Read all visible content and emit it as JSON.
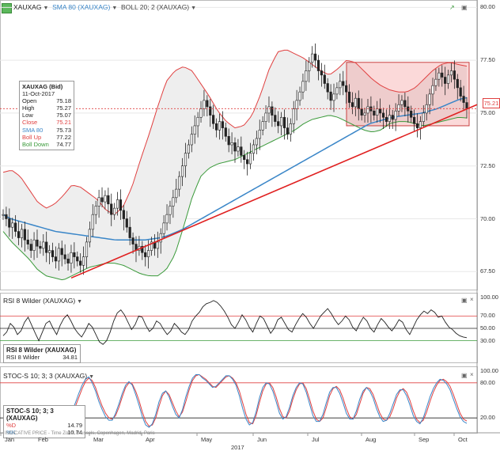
{
  "header": {
    "instrument": "XAUXAG",
    "sma": "SMA 80 (XAUXAG)",
    "boll": "BOLL 20; 2 (XAUXAG)"
  },
  "rsi_header": "RSI 8 Wilder (XAUXAG)",
  "stoch_header": "STOC-S 10; 3; 3 (XAUXAG)",
  "infobox": {
    "title": "XAUXAG (Bid)",
    "date": "11-Oct-2017",
    "rows": [
      {
        "label": "Open",
        "value": "75.18"
      },
      {
        "label": "High",
        "value": "75.27"
      },
      {
        "label": "Low",
        "value": "75.07"
      },
      {
        "label": "Close",
        "value": "75.21"
      },
      {
        "label": "SMA 80",
        "value": "75.73"
      },
      {
        "label": "Boll Up",
        "value": "77.22"
      },
      {
        "label": "Boll Down",
        "value": "74.77"
      }
    ]
  },
  "rsi_box": {
    "title": "RSI 8 Wilder (XAUXAG)",
    "label": "RSI 8 Wilder",
    "value": "34.81"
  },
  "stoch_box": {
    "title": "STOC-S 10; 3; 3 (XAUXAG)",
    "k_label": "%D",
    "k_value": "14.79",
    "d_label": "%K",
    "d_value": "10.74"
  },
  "last_price": "75.21",
  "footer": "INDICATIVE PRICE - Time Zone: Brussels, Copenhagen, Madrid, Paris",
  "year": "2017",
  "colors": {
    "sma": "#3a86c8",
    "boll_up": "#e04040",
    "boll_down": "#3a9a3a",
    "trend": "#e02020",
    "candle": "#222222"
  },
  "chart_data": [
    {
      "type": "candlestick",
      "title": "XAUXAG",
      "y_ticks": [
        "80.00",
        "77.50",
        "75.00",
        "72.50",
        "70.00",
        "67.50"
      ],
      "ylim": [
        66.8,
        80.2
      ],
      "x_ticks": [
        "Jan",
        "Feb",
        "Mar",
        "Apr",
        "May",
        "Jun",
        "Jul",
        "Aug",
        "Sep",
        "Oct"
      ],
      "close": [
        70.2,
        70.0,
        69.6,
        69.8,
        69.4,
        69.1,
        69.5,
        69.0,
        68.8,
        68.5,
        69.0,
        68.7,
        68.6,
        68.9,
        68.4,
        68.5,
        68.2,
        68.0,
        68.6,
        68.3,
        68.1,
        67.9,
        68.4,
        68.2,
        68.0,
        67.8,
        68.2,
        68.9,
        69.5,
        70.2,
        70.6,
        71.0,
        70.8,
        71.1,
        70.7,
        70.2,
        70.5,
        70.9,
        70.4,
        70.0,
        69.6,
        69.1,
        68.8,
        68.5,
        68.7,
        68.4,
        68.2,
        68.5,
        68.9,
        68.6,
        68.9,
        69.3,
        69.8,
        70.2,
        70.6,
        71.0,
        71.4,
        72.0,
        72.5,
        73.1,
        73.5,
        74.0,
        74.4,
        74.8,
        75.2,
        75.6,
        75.3,
        74.9,
        74.5,
        74.2,
        74.6,
        74.3,
        73.9,
        73.5,
        73.6,
        73.2,
        73.4,
        73.0,
        72.8,
        72.6,
        73.1,
        73.5,
        73.8,
        74.2,
        74.6,
        75.0,
        75.3,
        74.9,
        74.6,
        74.4,
        74.8,
        74.3,
        74.0,
        74.5,
        75.2,
        75.6,
        76.0,
        76.5,
        77.0,
        77.4,
        77.8,
        77.5,
        77.0,
        76.8,
        76.4,
        76.0,
        75.6,
        75.9,
        76.2,
        76.5,
        76.3,
        76.0,
        75.5,
        75.3,
        75.7,
        75.2,
        74.9,
        75.0,
        75.3,
        75.1,
        74.9,
        75.2,
        75.0,
        74.8,
        74.6,
        74.9,
        74.7,
        75.1,
        75.4,
        75.6,
        75.3,
        75.1,
        74.8,
        74.5,
        74.3,
        74.6,
        75.0,
        75.4,
        75.9,
        76.3,
        76.6,
        76.9,
        76.7,
        76.4,
        76.8,
        77.0,
        76.6,
        76.2,
        75.8,
        75.5,
        75.2
      ],
      "sma80": [
        70.2,
        70.0,
        69.9,
        69.8,
        69.7,
        69.6,
        69.5,
        69.4,
        69.35,
        69.3,
        69.25,
        69.2,
        69.15,
        69.1,
        69.05,
        69.0,
        69.0,
        69.0,
        69.0,
        69.0,
        69.05,
        69.1,
        69.2,
        69.35,
        69.5,
        69.7,
        69.9,
        70.1,
        70.3,
        70.5,
        70.7,
        70.9,
        71.1,
        71.3,
        71.5,
        71.7,
        71.9,
        72.1,
        72.3,
        72.5,
        72.7,
        72.9,
        73.1,
        73.3,
        73.5,
        73.7,
        73.9,
        74.1,
        74.3,
        74.5,
        74.6,
        74.7,
        74.8,
        74.85,
        74.9,
        74.95,
        75.0,
        75.1,
        75.2,
        75.35,
        75.5,
        75.65,
        75.73
      ],
      "boll_up": [
        72.2,
        72.3,
        72.0,
        71.4,
        70.8,
        70.5,
        70.7,
        71.1,
        71.6,
        71.5,
        71.2,
        70.9,
        70.4,
        70.2,
        70.6,
        71.5,
        72.8,
        74.0,
        75.3,
        76.5,
        77.0,
        77.2,
        77.0,
        76.4,
        75.8,
        75.1,
        74.6,
        74.3,
        74.4,
        74.9,
        75.9,
        77.1,
        77.9,
        78.0,
        77.8,
        77.6,
        77.3,
        77.0,
        76.8,
        77.1,
        77.5,
        77.4,
        77.0,
        76.6,
        76.3,
        76.1,
        76.0,
        76.0,
        76.2,
        76.6,
        77.0,
        77.3,
        77.4,
        77.3,
        77.22
      ],
      "boll_down": [
        69.4,
        68.9,
        68.5,
        68.1,
        67.6,
        67.3,
        67.2,
        67.1,
        67.3,
        67.5,
        67.7,
        67.8,
        67.9,
        67.9,
        67.8,
        67.6,
        67.4,
        67.3,
        67.3,
        67.6,
        68.3,
        69.6,
        71.0,
        72.0,
        72.4,
        72.6,
        72.7,
        72.8,
        73.0,
        73.2,
        73.4,
        73.6,
        73.8,
        74.0,
        74.2,
        74.5,
        74.7,
        74.8,
        74.9,
        74.8,
        74.6,
        74.4,
        74.2,
        74.1,
        74.2,
        74.5,
        74.6,
        74.6,
        74.5,
        74.4,
        74.5,
        74.6,
        74.7,
        74.8,
        74.77
      ],
      "trendline": [
        [
          67.2,
          "Feb"
        ],
        [
          75.4,
          "Oct"
        ]
      ],
      "range_box": [
        74.4,
        77.4
      ]
    },
    {
      "type": "line",
      "title": "RSI 8 Wilder (XAUXAG)",
      "y_ticks": [
        "100.00",
        "70.00",
        "50.00",
        "30.00"
      ],
      "levels": [
        70,
        50,
        30
      ],
      "ylim": [
        0,
        100
      ],
      "values": [
        38,
        44,
        58,
        52,
        40,
        46,
        60,
        68,
        55,
        42,
        30,
        44,
        58,
        62,
        50,
        40,
        55,
        66,
        72,
        62,
        50,
        42,
        36,
        46,
        58,
        52,
        40,
        28,
        24,
        30,
        44,
        62,
        75,
        80,
        72,
        60,
        48,
        56,
        70,
        68,
        55,
        45,
        50,
        62,
        58,
        48,
        40,
        46,
        58,
        52,
        44,
        40,
        48,
        62,
        70,
        76,
        85,
        90,
        92,
        95,
        92,
        86,
        78,
        68,
        56,
        50,
        60,
        72,
        64,
        52,
        44,
        58,
        70,
        66,
        54,
        42,
        50,
        64,
        68,
        58,
        48,
        44,
        56,
        66,
        74,
        68,
        58,
        50,
        60,
        70,
        76,
        82,
        74,
        64,
        56,
        62,
        70,
        64,
        52,
        46,
        58,
        68,
        62,
        50,
        44,
        56,
        66,
        60,
        52,
        46,
        54,
        64,
        60,
        48,
        40,
        52,
        64,
        72,
        78,
        74,
        80,
        76,
        68,
        70,
        60,
        52,
        48,
        42,
        38,
        36,
        34.81
      ]
    },
    {
      "type": "line",
      "title": "STOC-S 10; 3; 3 (XAUXAG)",
      "y_ticks": [
        "100.00",
        "80.00",
        "20.00"
      ],
      "levels": [
        80,
        20
      ],
      "ylim": [
        0,
        100
      ],
      "series": [
        {
          "name": "%D",
          "values": [
            40,
            35,
            25,
            20,
            22,
            28,
            40,
            55,
            70,
            82,
            88,
            84,
            72,
            55,
            40,
            28,
            20,
            18,
            24,
            38,
            56,
            72,
            80,
            78,
            66,
            50,
            30,
            14,
            6,
            8,
            20,
            40,
            58,
            66,
            60,
            46,
            32,
            22,
            30,
            48,
            68,
            84,
            92,
            94,
            90,
            86,
            80,
            74,
            72,
            78,
            84,
            90,
            92,
            88,
            80,
            66,
            46,
            26,
            12,
            10,
            24,
            46,
            66,
            78,
            80,
            72,
            56,
            36,
            22,
            20,
            32,
            52,
            68,
            78,
            80,
            70,
            52,
            32,
            18,
            14,
            20,
            38,
            58,
            70,
            74,
            68,
            54,
            36,
            22,
            18,
            26,
            44,
            62,
            72,
            70,
            60,
            44,
            28,
            18,
            16,
            22,
            36,
            54,
            66,
            70,
            64,
            50,
            32,
            18,
            12,
            16,
            30,
            48,
            64,
            76,
            84,
            86,
            82,
            74,
            60,
            44,
            28,
            18,
            14.79
          ]
        },
        {
          "name": "%K",
          "values": [
            38,
            30,
            20,
            16,
            22,
            32,
            46,
            62,
            76,
            86,
            90,
            80,
            66,
            48,
            34,
            22,
            16,
            16,
            28,
            44,
            62,
            76,
            82,
            76,
            60,
            42,
            22,
            8,
            4,
            10,
            26,
            48,
            62,
            66,
            56,
            40,
            26,
            20,
            34,
            56,
            74,
            88,
            94,
            94,
            88,
            84,
            78,
            72,
            74,
            80,
            86,
            92,
            92,
            86,
            76,
            58,
            36,
            18,
            8,
            12,
            30,
            54,
            72,
            80,
            78,
            66,
            48,
            28,
            18,
            22,
            38,
            58,
            72,
            80,
            78,
            64,
            44,
            24,
            14,
            14,
            26,
            46,
            64,
            72,
            72,
            62,
            46,
            28,
            18,
            18,
            32,
            52,
            66,
            72,
            66,
            54,
            36,
            22,
            14,
            16,
            28,
            44,
            60,
            68,
            68,
            58,
            42,
            24,
            14,
            10,
            20,
            38,
            56,
            70,
            80,
            86,
            84,
            78,
            68,
            52,
            36,
            22,
            14,
            10.74
          ]
        }
      ]
    }
  ]
}
